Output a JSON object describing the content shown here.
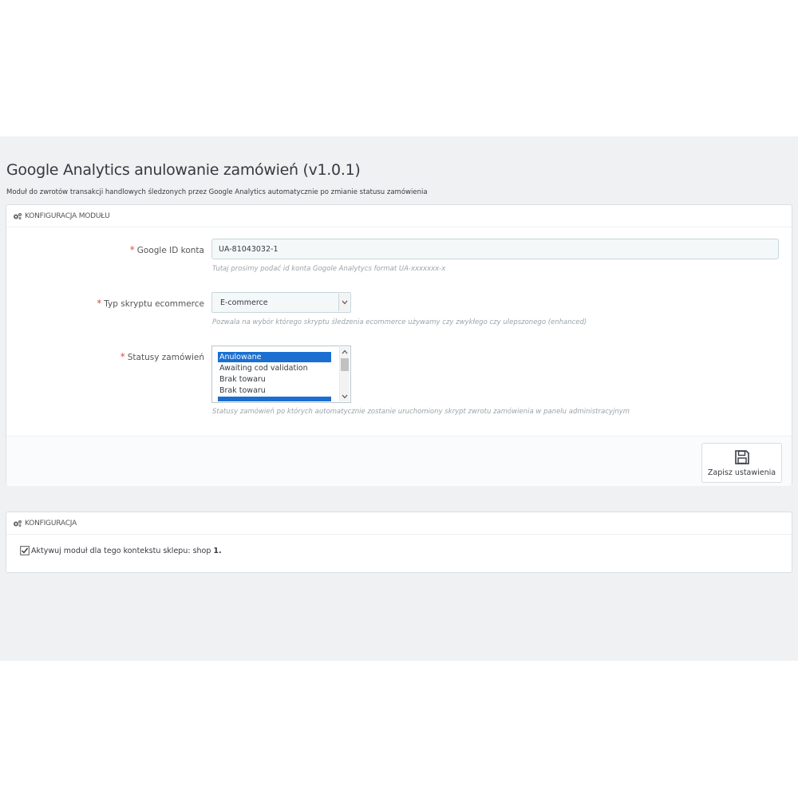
{
  "header": {
    "title": "Google Analytics anulowanie zamówień (v1.0.1)",
    "description": "Moduł do zwrotów transakcji handlowych śledzonych przez Google Analytics automatycznie po zmianie statusu zamówienia"
  },
  "config_panel": {
    "heading": "KONFIGURACJA MODUŁU",
    "google_id": {
      "label": "Google ID konta",
      "required_mark": "*",
      "value": "UA-81043032-1",
      "help": "Tutaj prosimy podać id konta Gogole Analytycs format UA-xxxxxxx-x"
    },
    "script_type": {
      "label": "Typ skryptu ecommerce",
      "required_mark": "*",
      "selected": "E-commerce",
      "help": "Pozwala na wybór którego skryptu śledzenia ecommerce używamy czy zwykłego czy ulepszonego (enhanced)"
    },
    "order_statuses": {
      "label": "Statusy zamówień",
      "required_mark": "*",
      "options": [
        {
          "label": "Anulowane",
          "selected": true
        },
        {
          "label": "Awaiting cod validation",
          "selected": false
        },
        {
          "label": "Brak towaru",
          "selected": false
        },
        {
          "label": "Brak towaru",
          "selected": false
        }
      ],
      "help": "Statusy zamówień po których automatycznie zostanie uruchomiony skrypt zwrotu zamówienia w panelu administracyjnym"
    },
    "save_label": "Zapisz ustawienia"
  },
  "context_panel": {
    "heading": "KONFIGURACJA",
    "checkbox_label": "Aktywuj moduł dla tego kontekstu sklepu: shop",
    "checkbox_value": "1.",
    "checked": true
  },
  "colors": {
    "required": "#e34b4b",
    "selected_option": "#1a6fd1",
    "background": "#eff1f2"
  }
}
